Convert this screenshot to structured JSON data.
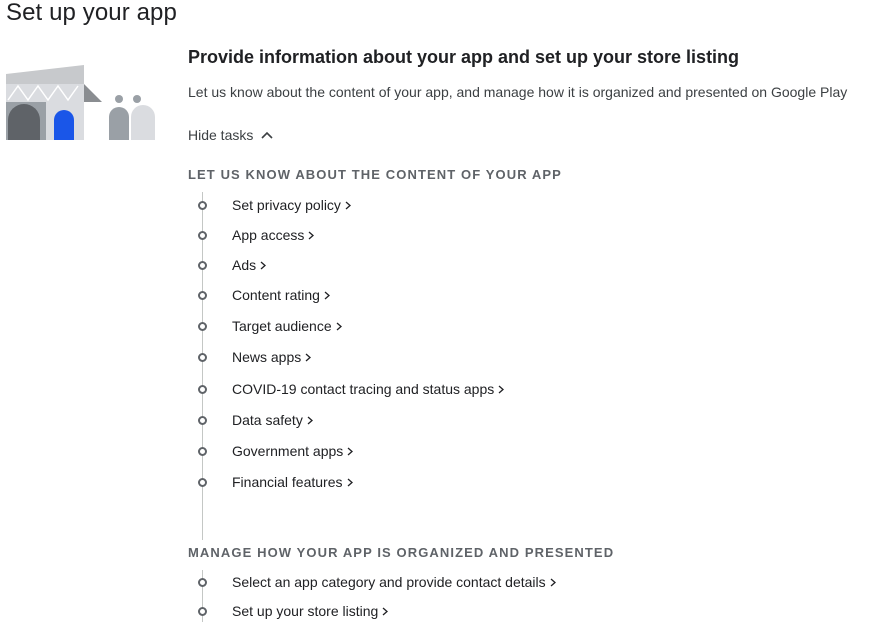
{
  "page": {
    "title": "Set up your app"
  },
  "section": {
    "heading": "Provide information about your app and set up your store listing",
    "subtitle": "Let us know about the content of your app, and manage how it is organized and presented on Google Play",
    "toggle_label": "Hide tasks"
  },
  "groups": [
    {
      "title": "LET US KNOW ABOUT THE CONTENT OF YOUR APP",
      "tasks": [
        "Set privacy policy",
        "App access",
        "Ads",
        "Content rating",
        "Target audience",
        "News apps",
        "COVID-19 contact tracing and status apps",
        "Data safety",
        "Government apps",
        "Financial features"
      ]
    },
    {
      "title": "MANAGE HOW YOUR APP IS ORGANIZED AND PRESENTED",
      "tasks": [
        "Select an app category and provide contact details",
        "Set up your store listing"
      ]
    }
  ],
  "icons": {
    "toggle": "chevron-up-icon",
    "task_marker": "circle-outline-icon",
    "task_link": "chevron-right-icon"
  },
  "colors": {
    "accent_blue": "#1a56e8",
    "text_primary": "#202124",
    "text_secondary": "#5f6368"
  }
}
